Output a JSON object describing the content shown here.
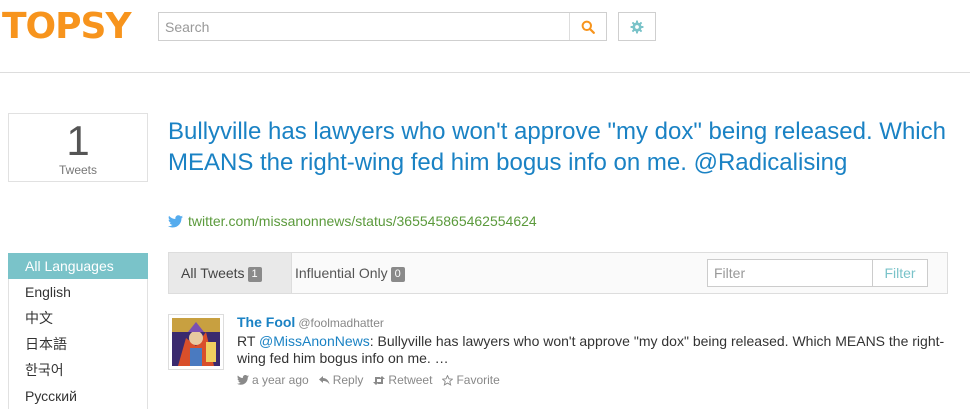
{
  "header": {
    "logo": "TOPSY",
    "search_placeholder": "Search"
  },
  "count": {
    "value": "1",
    "label": "Tweets"
  },
  "title": "Bullyville has lawyers who won't approve \"my dox\" being released. Which MEANS the right-wing fed him bogus info on me. @Radicalising",
  "source": "twitter.com/missanonnews/status/365545865462554624",
  "languages": [
    "All Languages",
    "English",
    "中文",
    "日本語",
    "한국어",
    "Русский"
  ],
  "tabs": {
    "all_label": "All Tweets",
    "all_count": "1",
    "influential_label": "Influential Only",
    "influential_count": "0"
  },
  "filter": {
    "placeholder": "Filter",
    "button": "Filter"
  },
  "tweet": {
    "author": "The Fool",
    "handle": "@foolmadhatter",
    "prefix": "RT ",
    "mention": "@MissAnonNews",
    "text": ": Bullyville has lawyers who won't approve \"my dox\" being released. Which MEANS the right-wing fed him bogus info on me. …",
    "time": "a year ago",
    "reply": "Reply",
    "retweet": "Retweet",
    "favorite": "Favorite"
  },
  "colors": {
    "brand": "#f7941d",
    "link": "#1a82c4",
    "accent": "#7ac3c9",
    "source": "#5b9a3c"
  }
}
